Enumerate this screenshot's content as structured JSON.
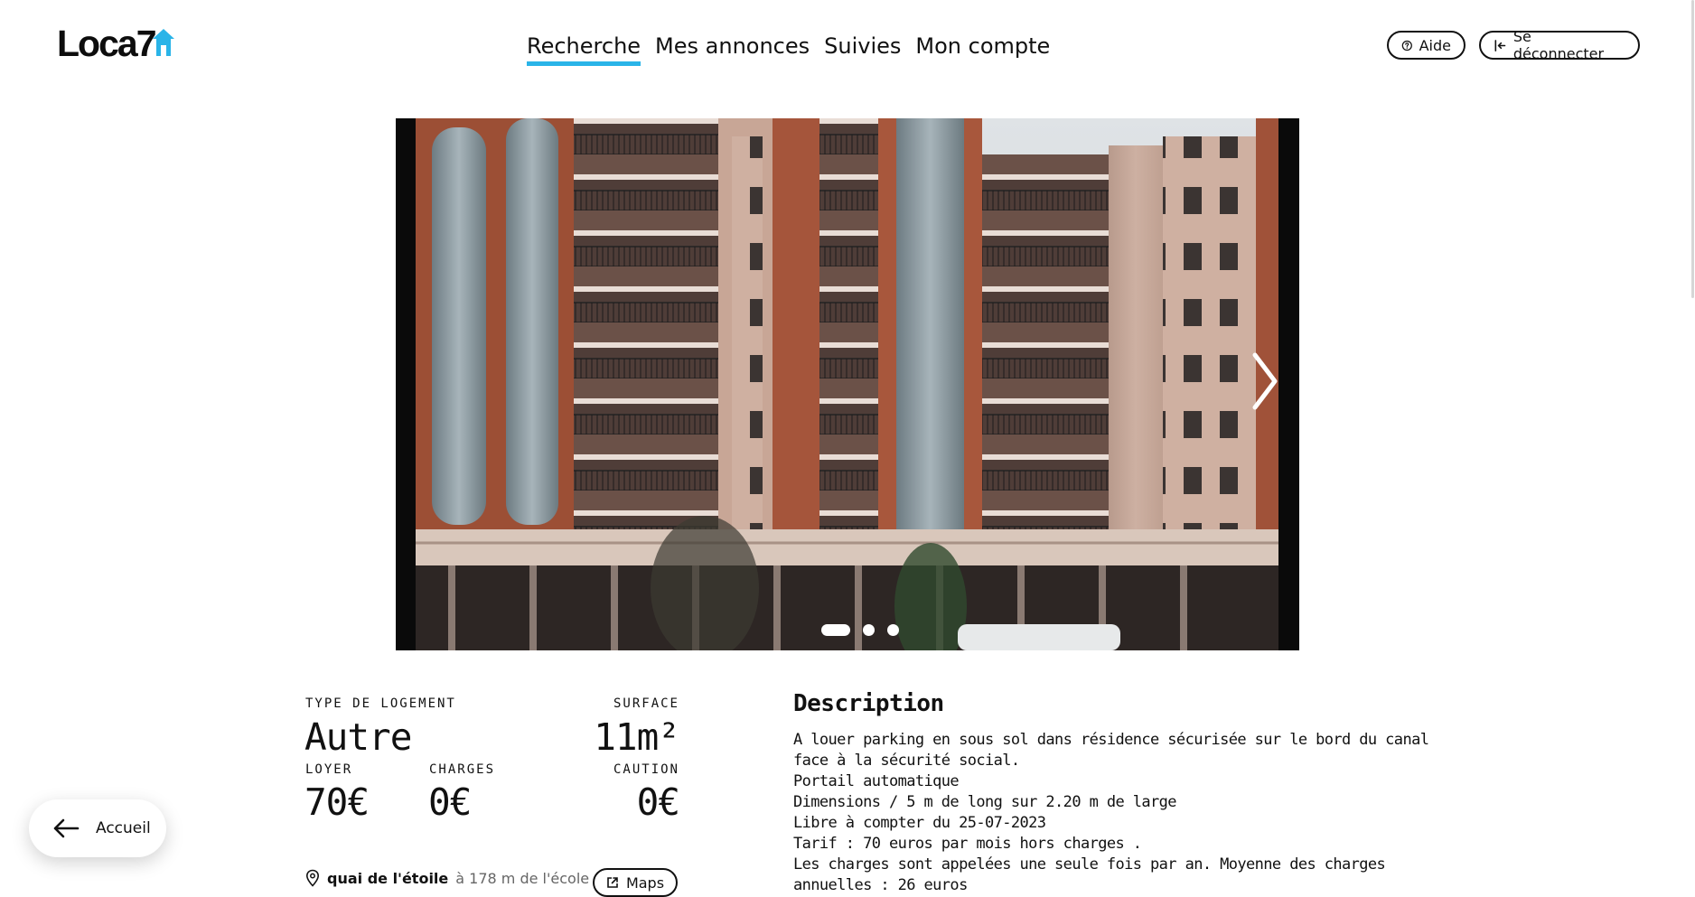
{
  "brand": {
    "logo_text": "Loca7",
    "accent": "#2ab4e8"
  },
  "nav": {
    "items": [
      {
        "label": "Recherche",
        "active": true
      },
      {
        "label": "Mes annonces",
        "active": false
      },
      {
        "label": "Suivies",
        "active": false
      },
      {
        "label": "Mon compte",
        "active": false
      }
    ]
  },
  "header_actions": {
    "help_label": "Aide",
    "help_icon": "question-circle-icon",
    "logout_label": "Se déconnecter",
    "logout_icon": "logout-icon"
  },
  "carousel": {
    "slide_count": 3,
    "active_index": 0,
    "next_icon": "chevron-right-icon"
  },
  "listing": {
    "type_label": "TYPE DE LOGEMENT",
    "type_value": "Autre",
    "surface_label": "SURFACE",
    "surface_value": "11m²",
    "rent_label": "LOYER",
    "rent_value": "70€",
    "charges_label": "CHARGES",
    "charges_value": "0€",
    "deposit_label": "CAUTION",
    "deposit_value": "0€",
    "address_street": "quai de l'étoile",
    "address_distance": "à 178 m de l'école",
    "maps_label": "Maps"
  },
  "description": {
    "title": "Description",
    "lines": [
      "A louer parking en sous sol dans résidence sécurisée sur le bord du canal",
      "face à la sécurité social.",
      "Portail automatique",
      "Dimensions / 5 m de long sur 2.20 m de large",
      "Libre à compter du 25-07-2023",
      "Tarif : 70 euros par mois hors charges .",
      "Les charges sont appelées une seule fois par an. Moyenne des charges",
      "annuelles : 26 euros"
    ]
  },
  "home_button": {
    "label": "Accueil",
    "icon": "arrow-left-icon"
  }
}
